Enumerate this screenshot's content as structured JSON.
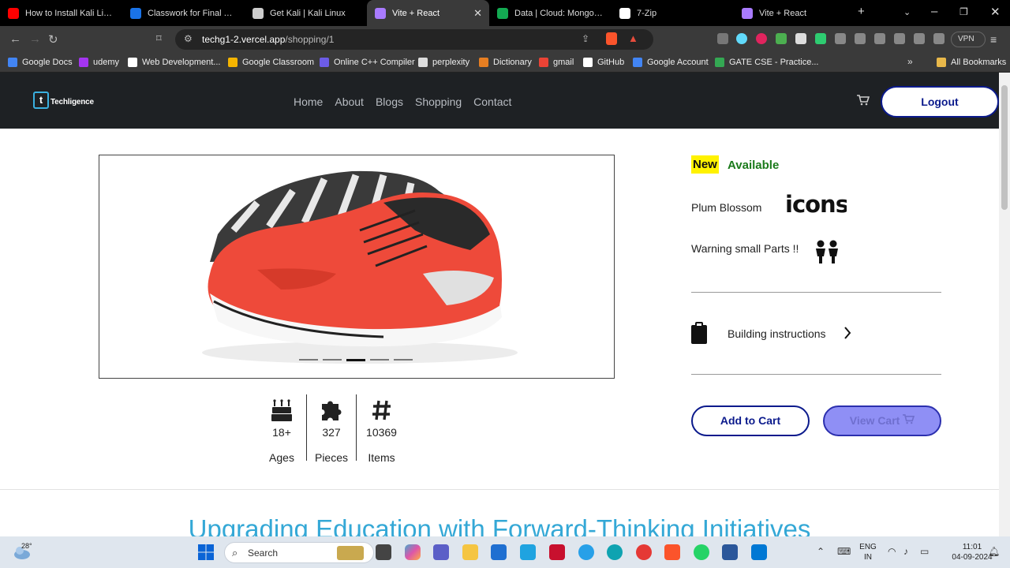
{
  "browser": {
    "tabs": [
      {
        "title": "How to Install Kali Linux in",
        "color": "#ff0000"
      },
      {
        "title": "Classwork for Final Year C",
        "color": "#1a73e8"
      },
      {
        "title": "Get Kali | Kali Linux",
        "color": "#cccccc"
      },
      {
        "title": "Vite + React",
        "color": "#a97bff",
        "active": true
      },
      {
        "title": "Data | Cloud: MongoDB C",
        "color": "#13aa52"
      },
      {
        "title": "7-Zip",
        "color": "#ffffff"
      },
      {
        "title": "Vite + React",
        "color": "#a97bff"
      }
    ],
    "url_host": "techg1-2.vercel.app",
    "url_path": "/shopping/1",
    "vpn_label": "VPN",
    "bookmarks": [
      {
        "label": "Google Docs",
        "color": "#4285f4"
      },
      {
        "label": "udemy",
        "color": "#a435f0"
      },
      {
        "label": "Web Development...",
        "color": "#ffffff"
      },
      {
        "label": "Google Classroom",
        "color": "#f4b400"
      },
      {
        "label": "Online C++ Compiler",
        "color": "#6c5ce7"
      },
      {
        "label": "perplexity",
        "color": "#dddddd"
      },
      {
        "label": "Dictionary",
        "color": "#e67e22"
      },
      {
        "label": "gmail",
        "color": "#ea4335"
      },
      {
        "label": "GitHub",
        "color": "#ffffff"
      },
      {
        "label": "Google Account",
        "color": "#4285f4"
      },
      {
        "label": "GATE CSE - Practice...",
        "color": "#34a853"
      }
    ],
    "all_bookmarks": "All Bookmarks"
  },
  "site": {
    "logo_text": "Techligence",
    "nav": [
      "Home",
      "About",
      "Blogs",
      "Shopping",
      "Contact"
    ],
    "logout": "Logout"
  },
  "product": {
    "badge_new": "New",
    "badge_available": "Available",
    "feature1": "Plum Blossom",
    "feature2": "Warning small Parts !!",
    "instructions": "Building instructions",
    "add_to_cart": "Add to Cart",
    "view_cart": "View Cart",
    "stats": [
      {
        "value": "18+",
        "label": "Ages",
        "icon": "cake-icon"
      },
      {
        "value": "327",
        "label": "Pieces",
        "icon": "puzzle-icon"
      },
      {
        "value": "10369",
        "label": "Items",
        "icon": "hash-icon"
      }
    ],
    "carousel_active_index": 2,
    "carousel_count": 5
  },
  "section_heading": "Upgrading Education with Forward-Thinking Initiatives",
  "taskbar": {
    "weather": "28°",
    "search": "Search",
    "lang1": "ENG",
    "lang2": "IN",
    "time": "11:01",
    "date": "04-09-2024"
  }
}
